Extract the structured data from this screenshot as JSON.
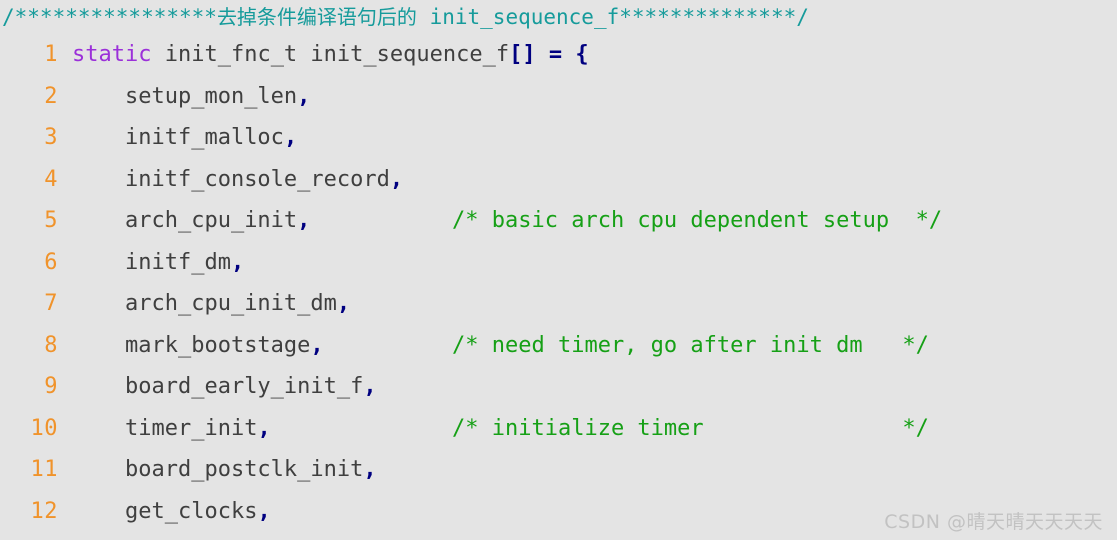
{
  "editor": {
    "background_color": "#e4e4e4",
    "banner": {
      "lead_stars": "/****************",
      "cjk_text": "去掉条件编译语句后的",
      "symbol": " init_sequence_f",
      "trail_stars": "**************/",
      "color": "#169b9b"
    },
    "colors": {
      "line_number": "#f0932b",
      "keyword": "#9b30d9",
      "identifier": "#3f3f3f",
      "punctuation": "#000080",
      "comment": "#16a016",
      "banner_comment": "#169b9b"
    },
    "lines": [
      {
        "number": "1",
        "keyword": "static",
        "code_after_keyword": " init_fnc_t init_sequence_f",
        "brackets": "[]",
        "assign": " = {",
        "comment": ""
      },
      {
        "number": "2",
        "indent": "    ",
        "ident": "setup_mon_len",
        "comma": ",",
        "comment": ""
      },
      {
        "number": "3",
        "indent": "    ",
        "ident": "initf_malloc",
        "comma": ",",
        "comment": ""
      },
      {
        "number": "4",
        "indent": "    ",
        "ident": "initf_console_record",
        "comma": ",",
        "comment": ""
      },
      {
        "number": "5",
        "indent": "    ",
        "ident": "arch_cpu_init",
        "comma": ",",
        "comment": "/* basic arch cpu dependent setup  */"
      },
      {
        "number": "6",
        "indent": "    ",
        "ident": "initf_dm",
        "comma": ",",
        "comment": ""
      },
      {
        "number": "7",
        "indent": "    ",
        "ident": "arch_cpu_init_dm",
        "comma": ",",
        "comment": ""
      },
      {
        "number": "8",
        "indent": "    ",
        "ident": "mark_bootstage",
        "comma": ",",
        "comment": "/* need timer, go after init dm   */"
      },
      {
        "number": "9",
        "indent": "    ",
        "ident": "board_early_init_f",
        "comma": ",",
        "comment": ""
      },
      {
        "number": "10",
        "indent": "    ",
        "ident": "timer_init",
        "comma": ",",
        "comment": "/* initialize timer               */"
      },
      {
        "number": "11",
        "indent": "    ",
        "ident": "board_postclk_init",
        "comma": ",",
        "comment": ""
      },
      {
        "number": "12",
        "indent": "    ",
        "ident": "get_clocks",
        "comma": ",",
        "comment": ""
      }
    ]
  },
  "watermark": {
    "text": "CSDN @晴天晴天天天天"
  }
}
